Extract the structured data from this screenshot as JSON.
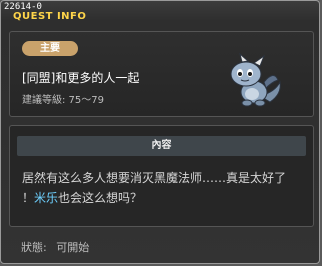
{
  "window": {
    "quest_id": "22614-0",
    "title": "QUEST INFO"
  },
  "quest": {
    "category_badge": "主要",
    "name": "[同盟]和更多的人一起",
    "level": "建議等級: 75～79",
    "npc_icon": "baby-dragon-npc-icon"
  },
  "content": {
    "header": "內容",
    "text_line1": "居然有这么多人想要消灭黑魔法师……真是太好了",
    "text_prefix": "！",
    "npc_name": "米乐",
    "text_suffix": "也会这么想吗？"
  },
  "status": {
    "label": "狀態:",
    "value": "可開始"
  },
  "colors": {
    "title": "#ffd54a",
    "badge": "#c9a26b",
    "npc_highlight": "#6ed1ff"
  }
}
